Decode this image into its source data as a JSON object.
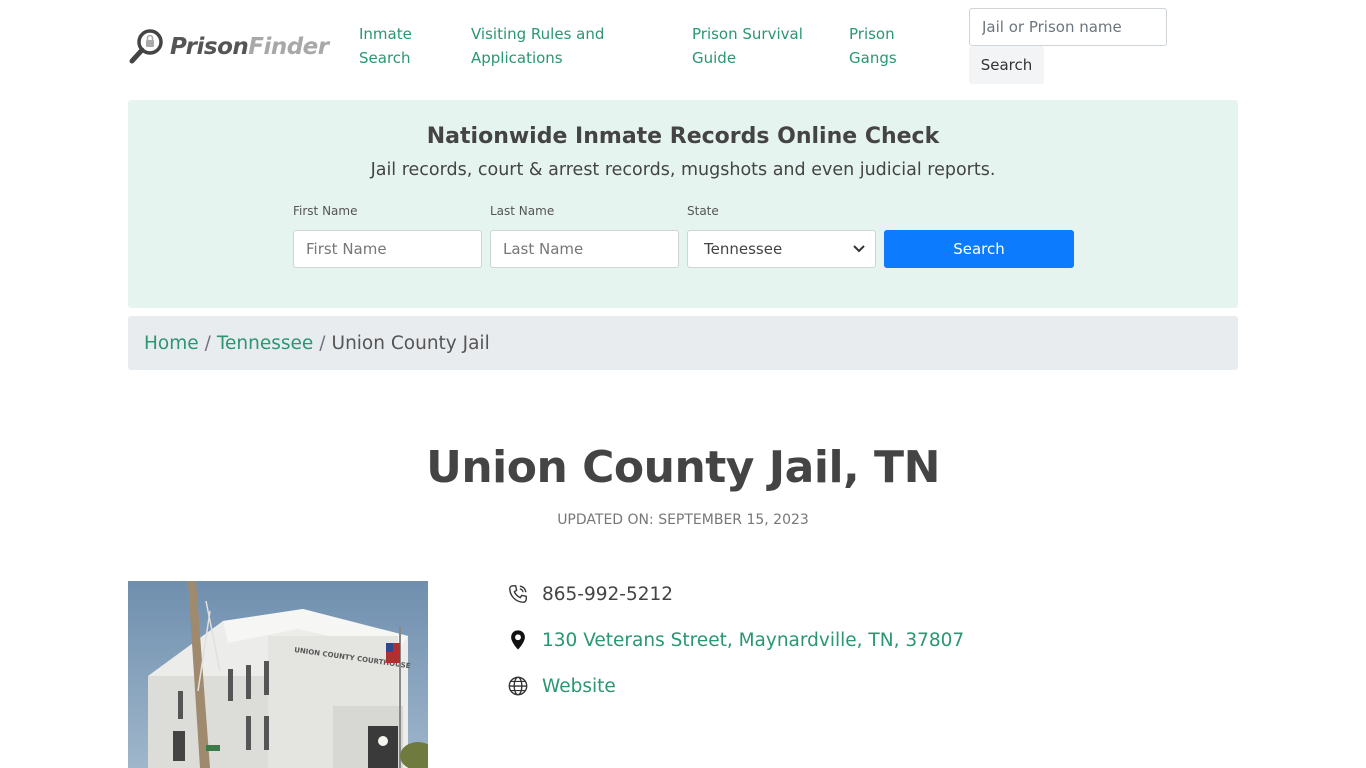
{
  "brand": {
    "name_part1": "Prison",
    "name_part2": "Finder",
    "colors": {
      "accent_green": "#2a9672",
      "primary_blue": "#0d7bfd",
      "panel_bg": "#e6f4f0",
      "breadcrumb_bg": "#e9ecef"
    }
  },
  "nav": {
    "items": [
      {
        "label": "Inmate Search"
      },
      {
        "label": "Visiting Rules and Applications"
      },
      {
        "label": "Prison Survival Guide"
      },
      {
        "label": "Prison Gangs"
      }
    ]
  },
  "header_search": {
    "placeholder": "Jail or Prison name",
    "button_label": "Search"
  },
  "records": {
    "title": "Nationwide Inmate Records Online Check",
    "subtitle": "Jail records, court & arrest records, mugshots and even judicial reports.",
    "first_name_label": "First Name",
    "first_name_placeholder": "First Name",
    "last_name_label": "Last Name",
    "last_name_placeholder": "Last Name",
    "state_label": "State",
    "state_value": "Tennessee",
    "search_button": "Search"
  },
  "breadcrumb": {
    "home": "Home",
    "sep1": "/",
    "state": "Tennessee",
    "sep2": "/",
    "current": "Union County Jail"
  },
  "page": {
    "title": "Union County Jail, TN",
    "updated": "UPDATED ON: SEPTEMBER 15, 2023"
  },
  "photo": {
    "sign_text": "UNION COUNTY COURTHOUSE"
  },
  "contact": {
    "phone": "865-992-5212",
    "address": "130 Veterans Street, Maynardville, TN, 37807",
    "website_label": "Website",
    "icons": [
      "phone-icon",
      "map-pin-icon",
      "globe-icon"
    ]
  }
}
